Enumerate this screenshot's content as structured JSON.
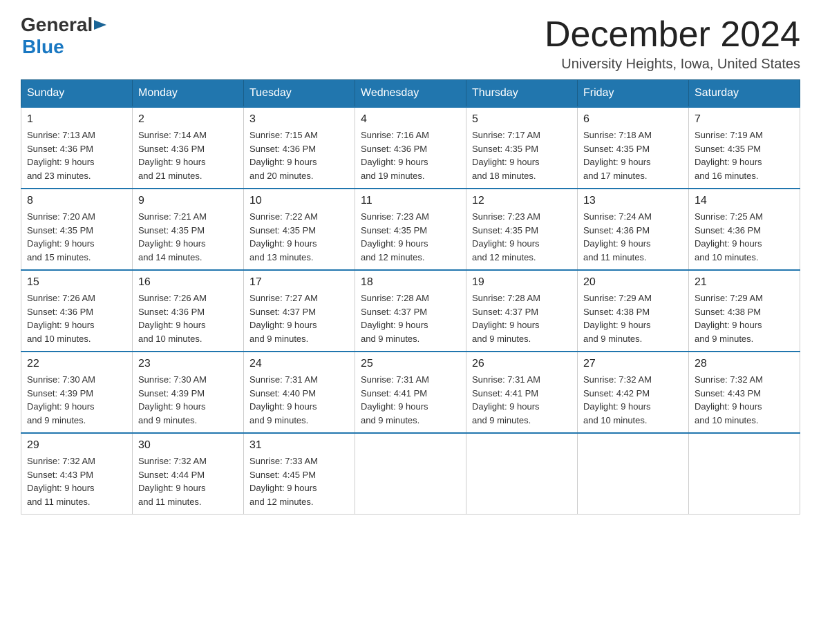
{
  "logo": {
    "general": "General",
    "blue": "Blue"
  },
  "title": "December 2024",
  "location": "University Heights, Iowa, United States",
  "weekdays": [
    "Sunday",
    "Monday",
    "Tuesday",
    "Wednesday",
    "Thursday",
    "Friday",
    "Saturday"
  ],
  "weeks": [
    [
      {
        "day": "1",
        "sunrise": "7:13 AM",
        "sunset": "4:36 PM",
        "daylight": "9 hours and 23 minutes."
      },
      {
        "day": "2",
        "sunrise": "7:14 AM",
        "sunset": "4:36 PM",
        "daylight": "9 hours and 21 minutes."
      },
      {
        "day": "3",
        "sunrise": "7:15 AM",
        "sunset": "4:36 PM",
        "daylight": "9 hours and 20 minutes."
      },
      {
        "day": "4",
        "sunrise": "7:16 AM",
        "sunset": "4:36 PM",
        "daylight": "9 hours and 19 minutes."
      },
      {
        "day": "5",
        "sunrise": "7:17 AM",
        "sunset": "4:35 PM",
        "daylight": "9 hours and 18 minutes."
      },
      {
        "day": "6",
        "sunrise": "7:18 AM",
        "sunset": "4:35 PM",
        "daylight": "9 hours and 17 minutes."
      },
      {
        "day": "7",
        "sunrise": "7:19 AM",
        "sunset": "4:35 PM",
        "daylight": "9 hours and 16 minutes."
      }
    ],
    [
      {
        "day": "8",
        "sunrise": "7:20 AM",
        "sunset": "4:35 PM",
        "daylight": "9 hours and 15 minutes."
      },
      {
        "day": "9",
        "sunrise": "7:21 AM",
        "sunset": "4:35 PM",
        "daylight": "9 hours and 14 minutes."
      },
      {
        "day": "10",
        "sunrise": "7:22 AM",
        "sunset": "4:35 PM",
        "daylight": "9 hours and 13 minutes."
      },
      {
        "day": "11",
        "sunrise": "7:23 AM",
        "sunset": "4:35 PM",
        "daylight": "9 hours and 12 minutes."
      },
      {
        "day": "12",
        "sunrise": "7:23 AM",
        "sunset": "4:35 PM",
        "daylight": "9 hours and 12 minutes."
      },
      {
        "day": "13",
        "sunrise": "7:24 AM",
        "sunset": "4:36 PM",
        "daylight": "9 hours and 11 minutes."
      },
      {
        "day": "14",
        "sunrise": "7:25 AM",
        "sunset": "4:36 PM",
        "daylight": "9 hours and 10 minutes."
      }
    ],
    [
      {
        "day": "15",
        "sunrise": "7:26 AM",
        "sunset": "4:36 PM",
        "daylight": "9 hours and 10 minutes."
      },
      {
        "day": "16",
        "sunrise": "7:26 AM",
        "sunset": "4:36 PM",
        "daylight": "9 hours and 10 minutes."
      },
      {
        "day": "17",
        "sunrise": "7:27 AM",
        "sunset": "4:37 PM",
        "daylight": "9 hours and 9 minutes."
      },
      {
        "day": "18",
        "sunrise": "7:28 AM",
        "sunset": "4:37 PM",
        "daylight": "9 hours and 9 minutes."
      },
      {
        "day": "19",
        "sunrise": "7:28 AM",
        "sunset": "4:37 PM",
        "daylight": "9 hours and 9 minutes."
      },
      {
        "day": "20",
        "sunrise": "7:29 AM",
        "sunset": "4:38 PM",
        "daylight": "9 hours and 9 minutes."
      },
      {
        "day": "21",
        "sunrise": "7:29 AM",
        "sunset": "4:38 PM",
        "daylight": "9 hours and 9 minutes."
      }
    ],
    [
      {
        "day": "22",
        "sunrise": "7:30 AM",
        "sunset": "4:39 PM",
        "daylight": "9 hours and 9 minutes."
      },
      {
        "day": "23",
        "sunrise": "7:30 AM",
        "sunset": "4:39 PM",
        "daylight": "9 hours and 9 minutes."
      },
      {
        "day": "24",
        "sunrise": "7:31 AM",
        "sunset": "4:40 PM",
        "daylight": "9 hours and 9 minutes."
      },
      {
        "day": "25",
        "sunrise": "7:31 AM",
        "sunset": "4:41 PM",
        "daylight": "9 hours and 9 minutes."
      },
      {
        "day": "26",
        "sunrise": "7:31 AM",
        "sunset": "4:41 PM",
        "daylight": "9 hours and 9 minutes."
      },
      {
        "day": "27",
        "sunrise": "7:32 AM",
        "sunset": "4:42 PM",
        "daylight": "9 hours and 10 minutes."
      },
      {
        "day": "28",
        "sunrise": "7:32 AM",
        "sunset": "4:43 PM",
        "daylight": "9 hours and 10 minutes."
      }
    ],
    [
      {
        "day": "29",
        "sunrise": "7:32 AM",
        "sunset": "4:43 PM",
        "daylight": "9 hours and 11 minutes."
      },
      {
        "day": "30",
        "sunrise": "7:32 AM",
        "sunset": "4:44 PM",
        "daylight": "9 hours and 11 minutes."
      },
      {
        "day": "31",
        "sunrise": "7:33 AM",
        "sunset": "4:45 PM",
        "daylight": "9 hours and 12 minutes."
      },
      null,
      null,
      null,
      null
    ]
  ]
}
